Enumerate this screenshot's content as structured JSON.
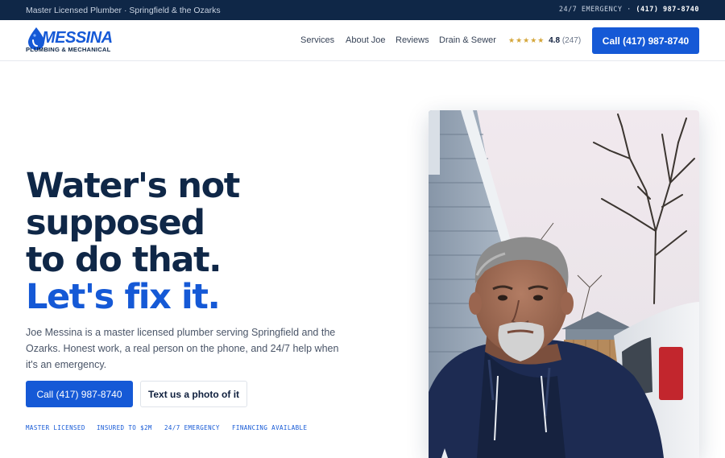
{
  "topbar": {
    "tagline": "Master Licensed Plumber · Springfield & the Ozarks",
    "emergency_label": "24/7 EMERGENCY ·",
    "emergency_phone": "(417) 987-8740"
  },
  "brand": {
    "name": "MESSINA",
    "subtitle": "PLUMBING & MECHANICAL",
    "accent_color": "#1559d6",
    "navy_color": "#0f2747"
  },
  "nav": {
    "items": [
      {
        "label": "Services"
      },
      {
        "label": "About Joe"
      },
      {
        "label": "Reviews"
      },
      {
        "label": "Drain & Sewer"
      }
    ]
  },
  "rating": {
    "stars": "★★★★★",
    "score": "4.8",
    "count": "(247)"
  },
  "header_cta": {
    "label": "Call (417) 987-8740"
  },
  "hero": {
    "headline_lines": [
      "Water's not",
      "supposed",
      "to do that."
    ],
    "headline_accent": "Let's fix it.",
    "intro": "Joe Messina is a master licensed plumber serving Springfield and the Ozarks. Honest work, a real person on the phone, and 24/7 help when it's an emergency.",
    "primary_button": "Call (417) 987-8740",
    "secondary_button": "Text us a photo of it",
    "badges": [
      "MASTER LICENSED",
      "INSURED TO $2M",
      "24/7 EMERGENCY",
      "FINANCING AVAILABLE"
    ]
  },
  "icons": {
    "logo_mark": "water-drop-icon",
    "rating": "star-icon"
  }
}
